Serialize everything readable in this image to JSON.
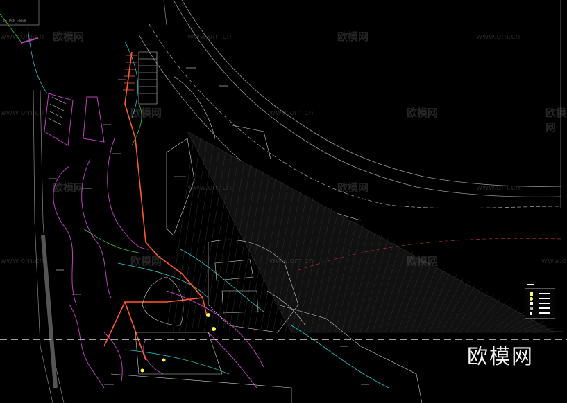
{
  "drawing": {
    "corner_label": "lp_PSN_xWk8",
    "brand": "欧模网",
    "colors": {
      "background": "#000000",
      "main_route": "#ff5a2a",
      "branch_pipe": "#c040c0",
      "secondary_pipe": "#2ac8c8",
      "building_outline": "#cfcfcf",
      "label_text": "#e8e8e8",
      "callout": "#ffff55",
      "dashed_boundary": "#ffffff"
    },
    "watermarks": [
      {
        "text": "www.om.cn"
      },
      {
        "text": "欧模网"
      },
      {
        "text": "www.om.cn"
      },
      {
        "text": "欧模网"
      },
      {
        "text": "www.om.cn"
      },
      {
        "text": "欧模网"
      },
      {
        "text": "www.om.cn"
      },
      {
        "text": "欧模网"
      },
      {
        "text": "www.om.cn"
      },
      {
        "text": "欧模网"
      },
      {
        "text": "www.om.cn"
      },
      {
        "text": "欧模网"
      },
      {
        "text": "www.om.cn"
      },
      {
        "text": "欧模网"
      },
      {
        "text": "www.om.cn"
      },
      {
        "text": "欧模网"
      },
      {
        "text": "www.om.cn"
      },
      {
        "text": "欧模网"
      },
      {
        "text": "www.om.cn"
      },
      {
        "text": "欧模网"
      }
    ],
    "legend_icons": [
      "light-fixture-icon",
      "sensor-icon",
      "junction-box-icon",
      "meter-icon",
      "arrow-icon"
    ]
  }
}
